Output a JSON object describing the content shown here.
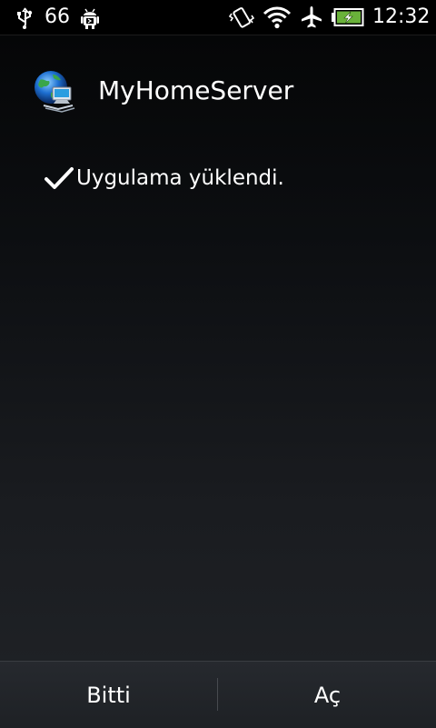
{
  "status_bar": {
    "notification_count": "66",
    "time": "12:32",
    "icons": [
      "usb-icon",
      "android-debug-icon",
      "vibrate-icon",
      "wifi-icon",
      "airplane-mode-icon",
      "battery-charging-icon"
    ]
  },
  "app": {
    "title": "MyHomeServer",
    "icon": "globe-network-app-icon"
  },
  "install_result": {
    "message": "Uygulama yüklendi.",
    "icon": "checkmark-icon"
  },
  "buttons": {
    "done_label": "Bitti",
    "open_label": "Aç"
  },
  "colors": {
    "battery_fill": "#6ab23a",
    "background_top": "#000000",
    "background_bottom": "#202327"
  }
}
